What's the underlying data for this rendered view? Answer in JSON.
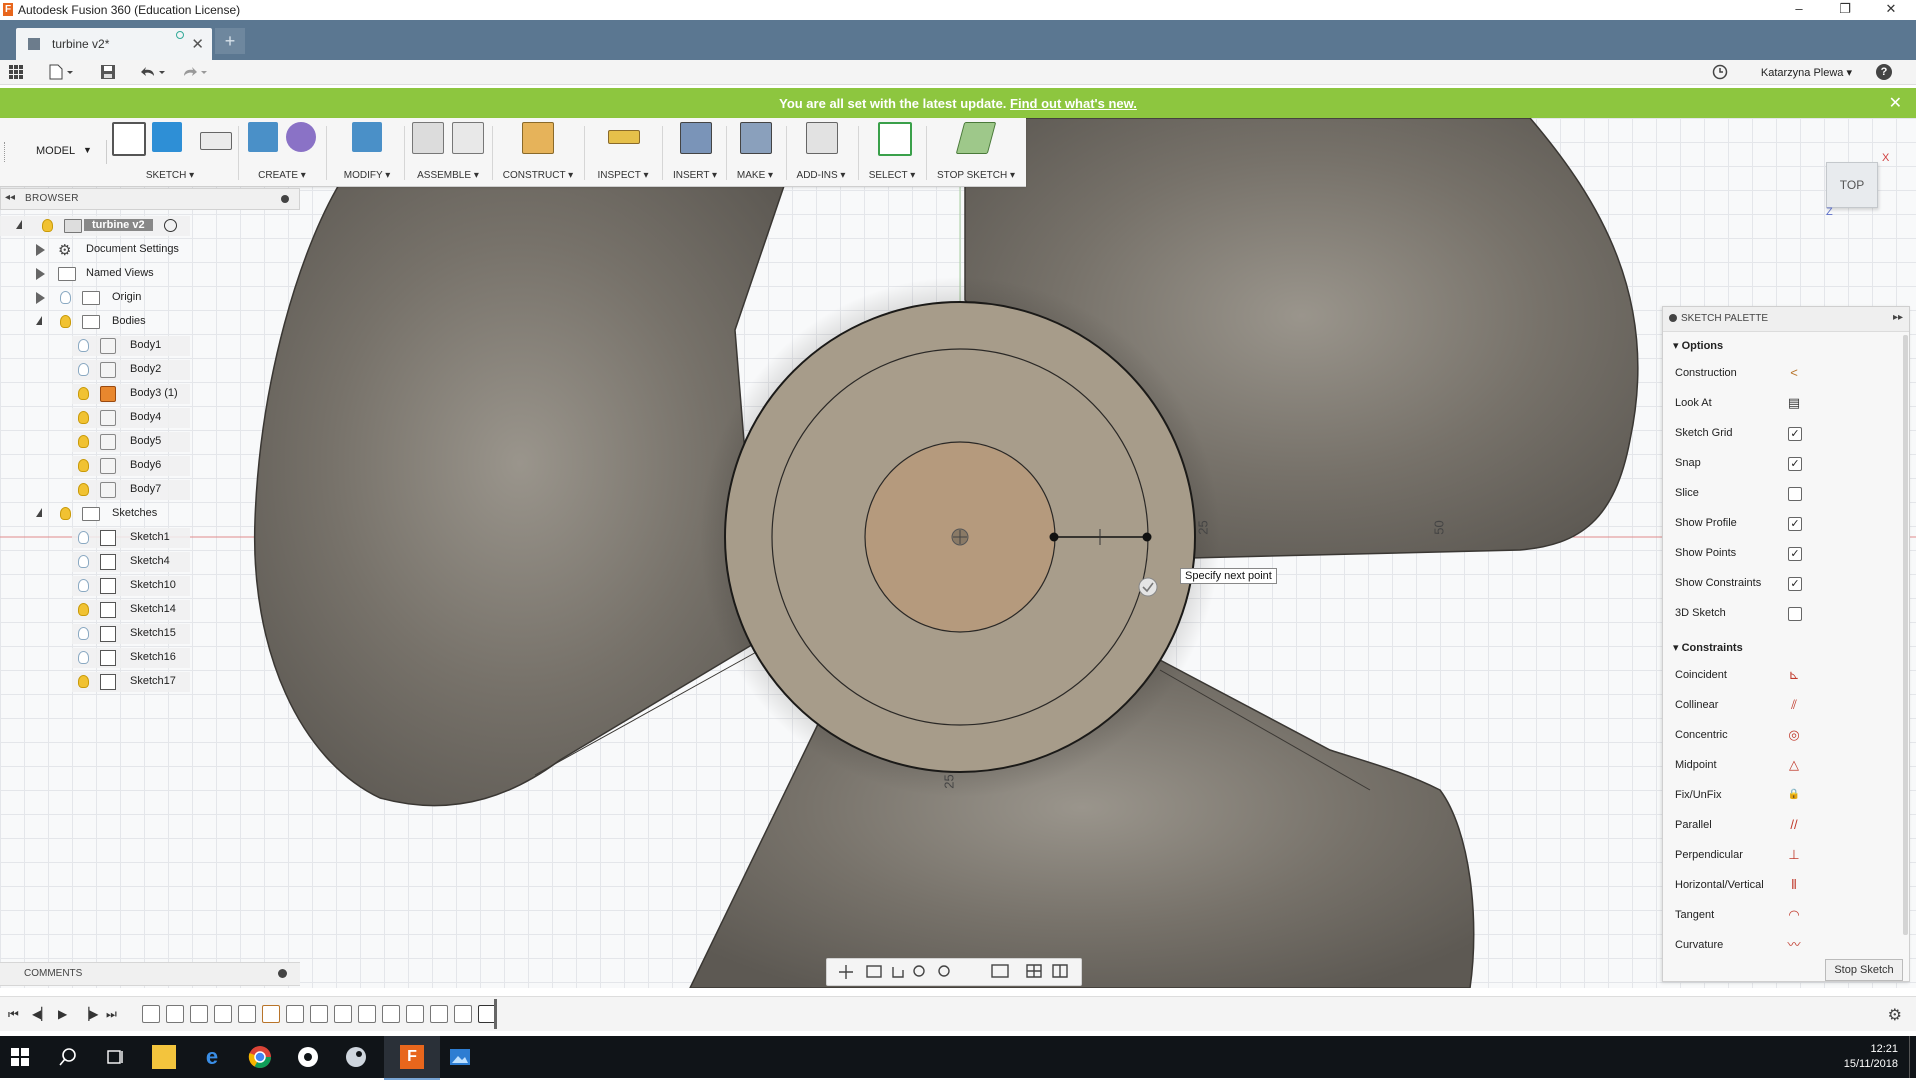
{
  "window": {
    "title": "Autodesk Fusion 360 (Education License)",
    "logo_letter": "F",
    "controls": [
      "–",
      "❐",
      "✕"
    ]
  },
  "tabs": {
    "active": "turbine v2*",
    "close": "✕",
    "new": "+"
  },
  "quick_access": {
    "user": "Katarzyna Plewa ▾",
    "help": "?"
  },
  "banner": {
    "message": "You are all set with the latest update.",
    "link": "Find out what's new.",
    "close": "✕"
  },
  "ribbon": {
    "workspace": "MODEL",
    "groups": [
      {
        "label": "SKETCH"
      },
      {
        "label": "CREATE"
      },
      {
        "label": "MODIFY"
      },
      {
        "label": "ASSEMBLE"
      },
      {
        "label": "CONSTRUCT"
      },
      {
        "label": "INSPECT"
      },
      {
        "label": "INSERT"
      },
      {
        "label": "MAKE"
      },
      {
        "label": "ADD-INS"
      },
      {
        "label": "SELECT"
      },
      {
        "label": "STOP SKETCH"
      }
    ]
  },
  "view_cube": {
    "face": "TOP",
    "x_label": "X",
    "z_label": "Z"
  },
  "browser": {
    "title": "BROWSER",
    "root": "turbine v2",
    "items": [
      {
        "label": "Document Settings"
      },
      {
        "label": "Named Views"
      },
      {
        "label": "Origin"
      },
      {
        "label": "Bodies"
      }
    ],
    "bodies": [
      "Body1",
      "Body2",
      "Body3 (1)",
      "Body4",
      "Body5",
      "Body6",
      "Body7"
    ],
    "sketches_label": "Sketches",
    "sketches": [
      "Sketch1",
      "Sketch4",
      "Sketch10",
      "Sketch14",
      "Sketch15",
      "Sketch16",
      "Sketch17"
    ]
  },
  "comments": {
    "title": "COMMENTS"
  },
  "canvas": {
    "tooltip": "Specify next point",
    "dim_right_1": "25",
    "dim_right_2": "50",
    "dim_bottom": "25"
  },
  "palette": {
    "title": "SKETCH PALETTE",
    "options_header": "Options",
    "options": [
      {
        "label": "Construction",
        "kind": "icon",
        "icon": "<"
      },
      {
        "label": "Look At",
        "kind": "icon",
        "icon": "▤"
      },
      {
        "label": "Sketch Grid",
        "kind": "check",
        "checked": "✓"
      },
      {
        "label": "Snap",
        "kind": "check",
        "checked": "✓"
      },
      {
        "label": "Slice",
        "kind": "check",
        "checked": ""
      },
      {
        "label": "Show Profile",
        "kind": "check",
        "checked": "✓"
      },
      {
        "label": "Show Points",
        "kind": "check",
        "checked": "✓"
      },
      {
        "label": "Show Constraints",
        "kind": "check",
        "checked": "✓"
      },
      {
        "label": "3D Sketch",
        "kind": "check",
        "checked": ""
      }
    ],
    "constraints_header": "Constraints",
    "constraints": [
      {
        "label": "Coincident",
        "icon": "⊾"
      },
      {
        "label": "Collinear",
        "icon": "⫽"
      },
      {
        "label": "Concentric",
        "icon": "◎"
      },
      {
        "label": "Midpoint",
        "icon": "△"
      },
      {
        "label": "Fix/UnFix",
        "icon": "🔒"
      },
      {
        "label": "Parallel",
        "icon": "//"
      },
      {
        "label": "Perpendicular",
        "icon": "⊥"
      },
      {
        "label": "Horizontal/Vertical",
        "icon": "⫴"
      },
      {
        "label": "Tangent",
        "icon": "◠"
      },
      {
        "label": "Curvature",
        "icon": "〰"
      }
    ],
    "stop_button": "Stop Sketch"
  },
  "taskbar": {
    "time": "12:21",
    "date": "15/11/2018"
  },
  "colors": {
    "banner": "#8dc63f",
    "tabbar": "#5b7791",
    "blade": "#7c776f",
    "hub": "#a79c8a",
    "core": "#b59a7d"
  }
}
